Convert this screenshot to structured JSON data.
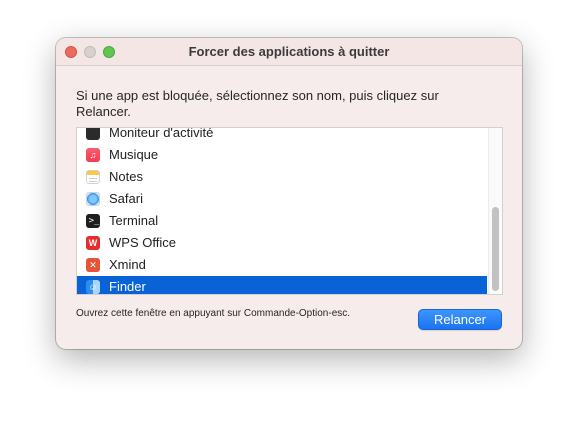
{
  "window": {
    "title": "Forcer des applications à quitter",
    "instruction": "Si une app est bloquée, sélectionnez son nom, puis cliquez sur Relancer.",
    "hint": "Ouvrez cette fenêtre en appuyant sur Commande-Option-esc.",
    "relaunch_label": "Relancer"
  },
  "apps": [
    {
      "name": "Moniteur d'activité",
      "icon": "activity-monitor-icon",
      "glyph": "",
      "selected": false
    },
    {
      "name": "Musique",
      "icon": "music-icon",
      "glyph": "♫",
      "selected": false
    },
    {
      "name": "Notes",
      "icon": "notes-icon",
      "glyph": "",
      "selected": false
    },
    {
      "name": "Safari",
      "icon": "safari-icon",
      "glyph": "",
      "selected": false
    },
    {
      "name": "Terminal",
      "icon": "terminal-icon",
      "glyph": ">_",
      "selected": false
    },
    {
      "name": "WPS Office",
      "icon": "wps-office-icon",
      "glyph": "W",
      "selected": false
    },
    {
      "name": "Xmind",
      "icon": "xmind-icon",
      "glyph": "✕",
      "selected": false
    },
    {
      "name": "Finder",
      "icon": "finder-icon",
      "glyph": "☺",
      "selected": true
    }
  ],
  "colors": {
    "selection": "#0a63d6",
    "accent": "#1b74ee"
  }
}
